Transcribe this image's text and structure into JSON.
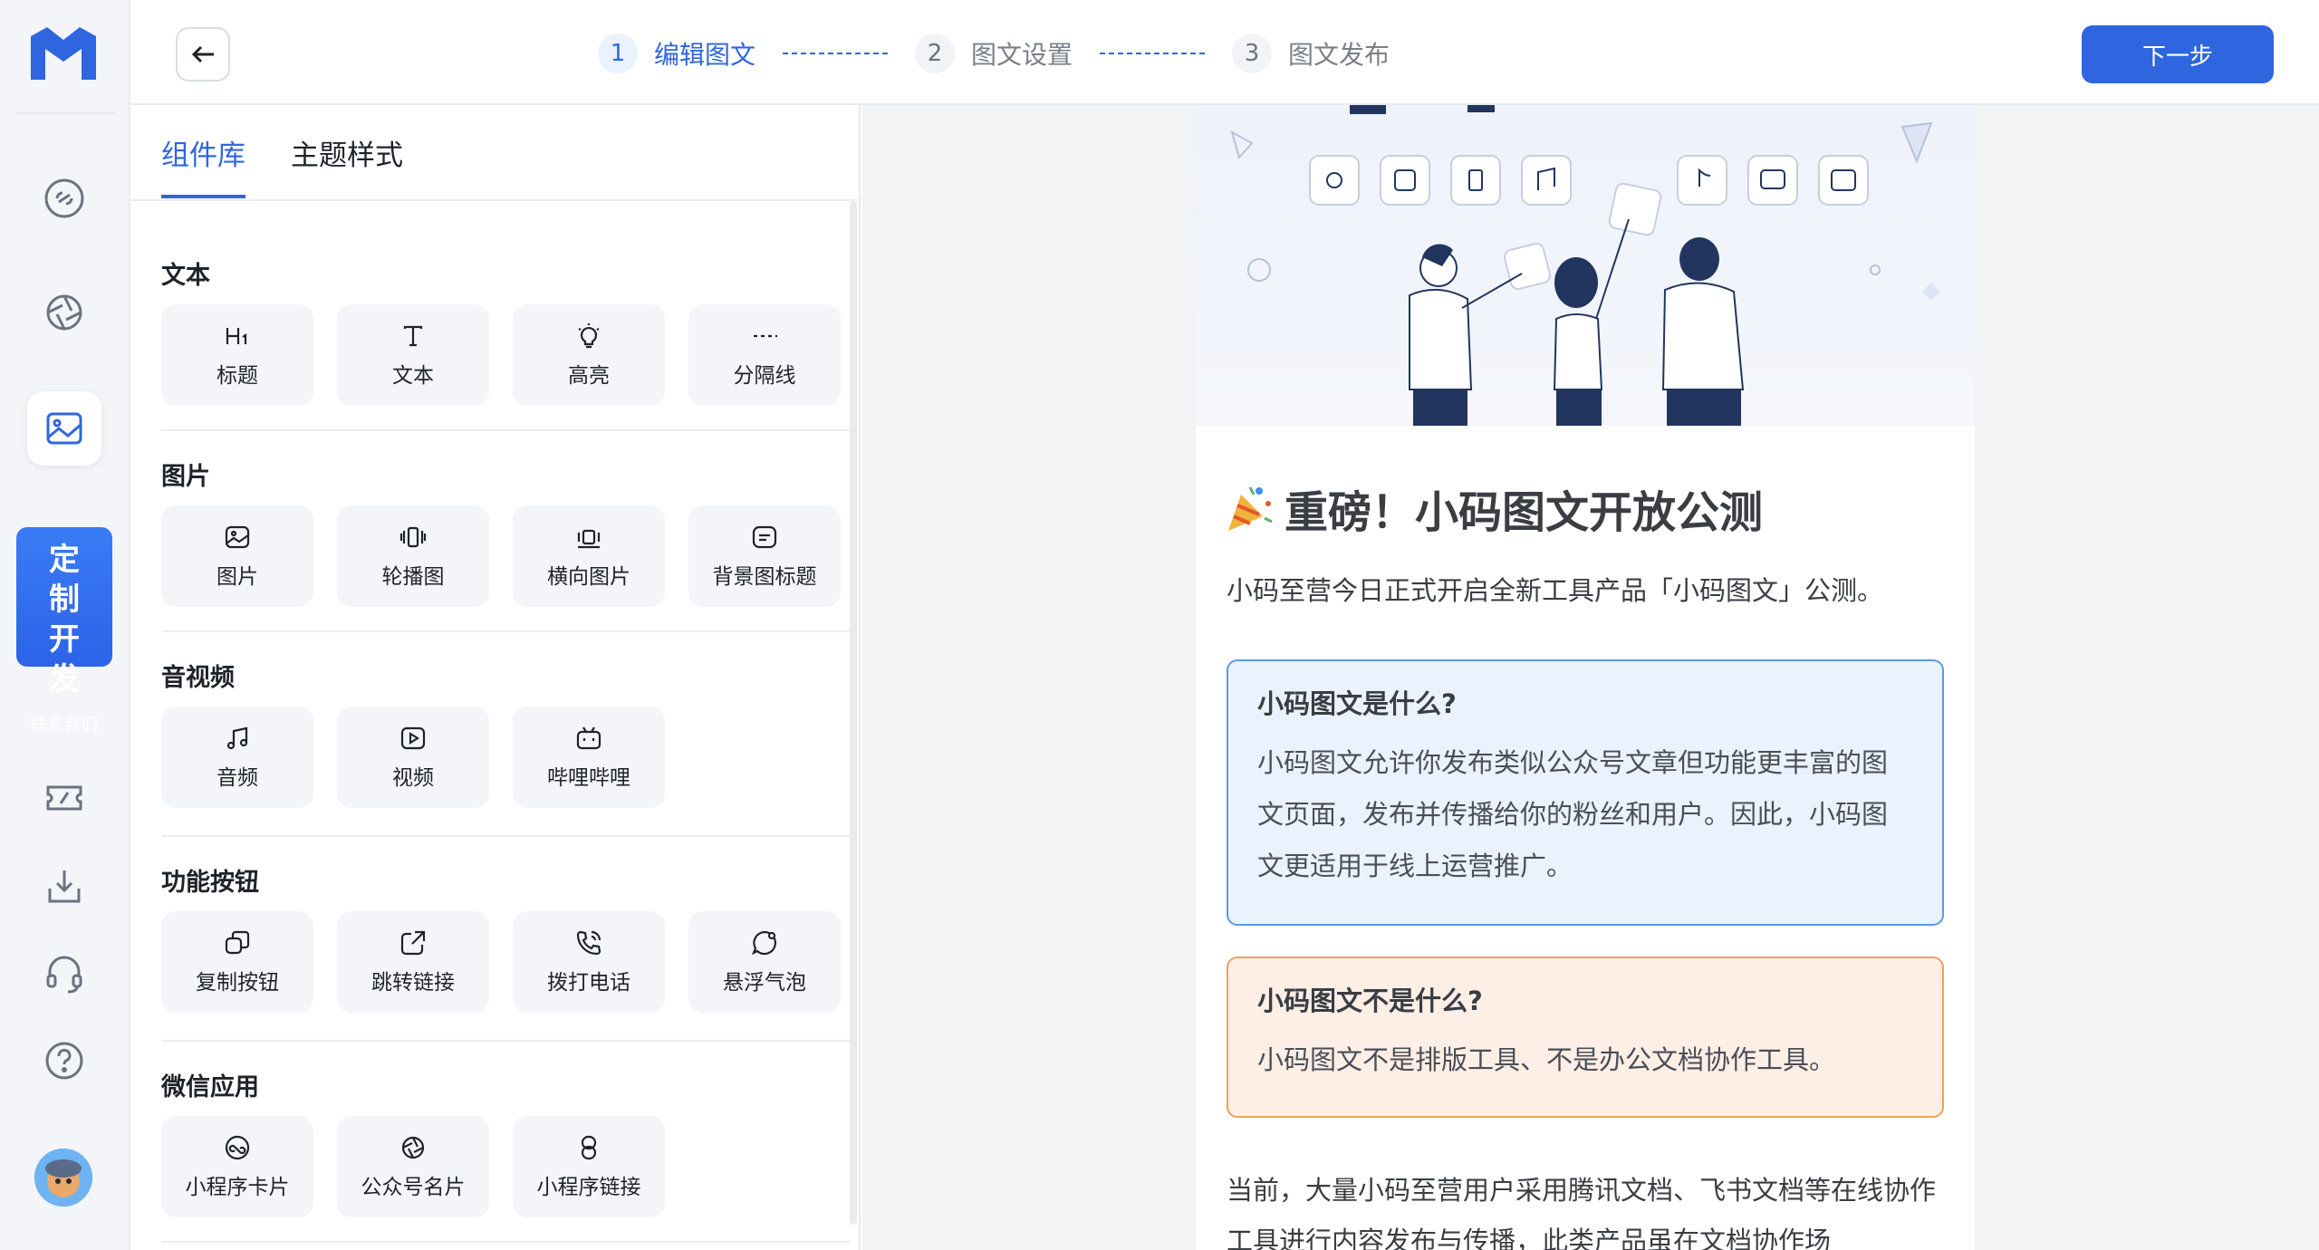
{
  "rail": {
    "custom_dev": {
      "line1": "定制",
      "line2": "开发",
      "cta": "联系我们"
    }
  },
  "topbar": {
    "steps": [
      {
        "num": "1",
        "label": "编辑图文"
      },
      {
        "num": "2",
        "label": "图文设置"
      },
      {
        "num": "3",
        "label": "图文发布"
      }
    ],
    "next_label": "下一步"
  },
  "panel": {
    "tabs": [
      "组件库",
      "主题样式"
    ],
    "sections": [
      {
        "title": "文本",
        "items": [
          "标题",
          "文本",
          "高亮",
          "分隔线"
        ]
      },
      {
        "title": "图片",
        "items": [
          "图片",
          "轮播图",
          "横向图片",
          "背景图标题"
        ]
      },
      {
        "title": "音视频",
        "items": [
          "音频",
          "视频",
          "哔哩哔哩"
        ]
      },
      {
        "title": "功能按钮",
        "items": [
          "复制按钮",
          "跳转链接",
          "拨打电话",
          "悬浮气泡"
        ]
      },
      {
        "title": "微信应用",
        "items": [
          "小程序卡片",
          "公众号名片",
          "小程序链接"
        ]
      }
    ]
  },
  "article": {
    "headline": "重磅！小码图文开放公测",
    "intro": "小码至营今日正式开启全新工具产品「小码图文」公测。",
    "what_title": "小码图文是什么?",
    "what_body": "小码图文允许你发布类似公众号文章但功能更丰富的图文页面，发布并传播给你的粉丝和用户。因此，小码图文更适用于线上运营推广。",
    "not_title": "小码图文不是什么?",
    "not_body": "小码图文不是排版工具、不是办公文档协作工具。",
    "bottom": "当前，大量小码至营用户采用腾讯文档、飞书文档等在线协作工具进行内容发布与传播，此类产品虽在文档协作场"
  },
  "colors": {
    "accent": "#2f66e0",
    "info_border": "#5b9be6",
    "warn_border": "#f0a05a"
  }
}
